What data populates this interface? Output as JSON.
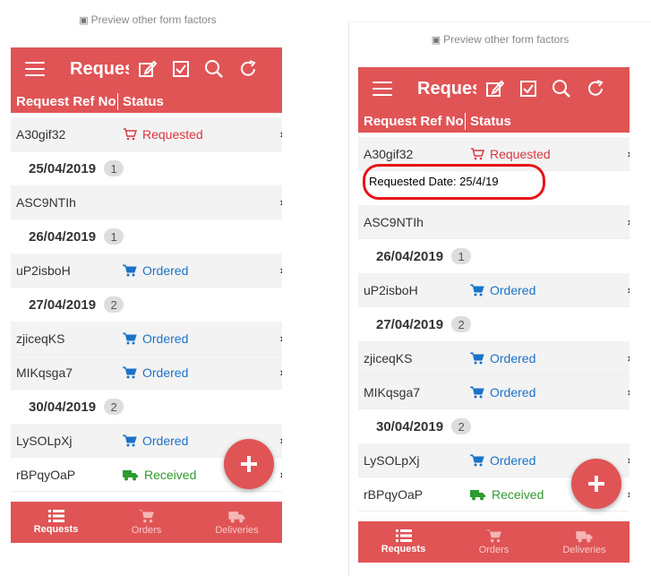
{
  "preview_text": "Preview other form factors",
  "app": {
    "title": "Requests",
    "column_ref": "Request Ref No",
    "column_status": "Status",
    "tabs": [
      {
        "label": "Requests",
        "active": true
      },
      {
        "label": "Orders",
        "active": false
      },
      {
        "label": "Deliveries",
        "active": false
      }
    ]
  },
  "rows": [
    {
      "ref": "A30gif32",
      "status": "Requested",
      "kind": "requested"
    },
    {
      "ref": "ASC9NTIh",
      "status": "",
      "kind": "none"
    },
    {
      "ref": "uP2isboH",
      "status": "Ordered",
      "kind": "ordered"
    },
    {
      "ref": "zjiceqKS",
      "status": "Ordered",
      "kind": "ordered"
    },
    {
      "ref": "MIKqsga7",
      "status": "Ordered",
      "kind": "ordered"
    },
    {
      "ref": "LySOLpXj",
      "status": "Ordered",
      "kind": "ordered"
    },
    {
      "ref": "rBPqyOaP",
      "status": "Received",
      "kind": "received"
    }
  ],
  "groups": [
    {
      "date": "25/04/2019",
      "count": "1"
    },
    {
      "date": "26/04/2019",
      "count": "1"
    },
    {
      "date": "27/04/2019",
      "count": "2"
    },
    {
      "date": "30/04/2019",
      "count": "2"
    }
  ],
  "annotation": "Requested Date: 25/4/19",
  "colors": {
    "primary": "#e05456",
    "requested": "#d9363e",
    "ordered": "#1a73c9",
    "received": "#2e9b2e",
    "highlight": "#e8141a"
  }
}
